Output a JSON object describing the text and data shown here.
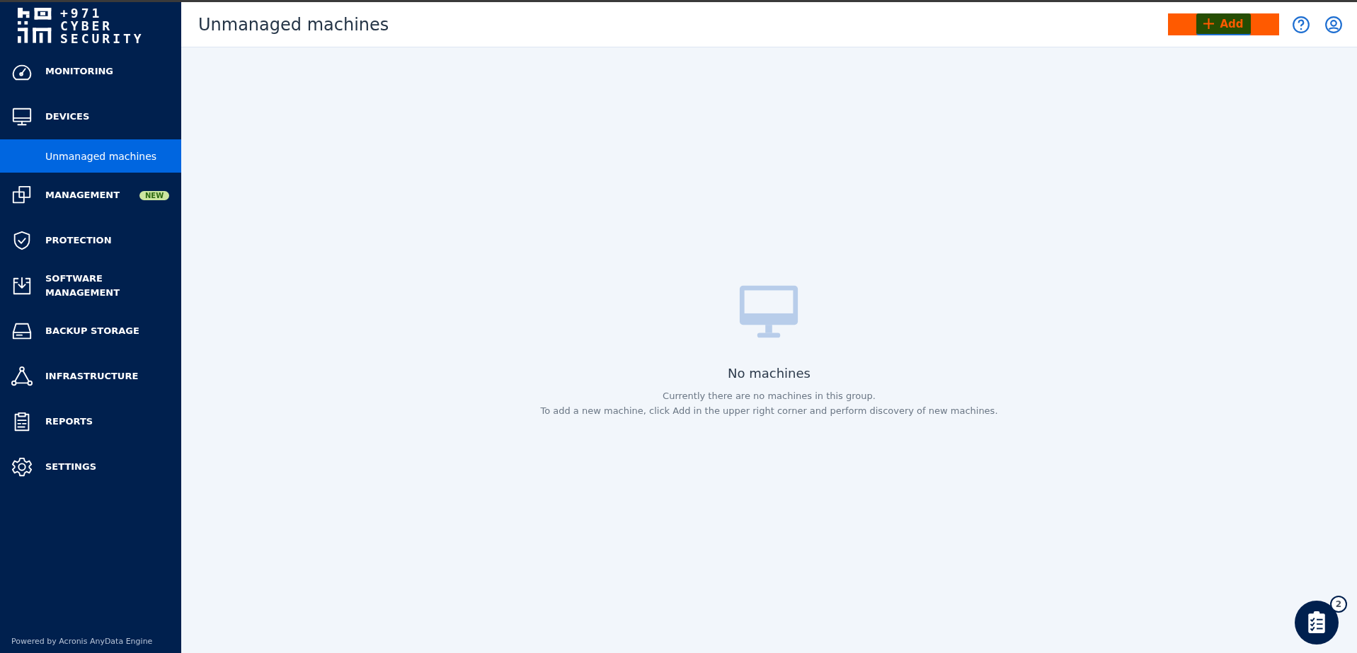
{
  "logo": {
    "lines": [
      "+971",
      "CYBER",
      "SECURITY"
    ]
  },
  "sidebar": {
    "items": [
      {
        "label": "MONITORING",
        "kind": "gauge",
        "selected": false
      },
      {
        "label": "DEVICES",
        "kind": "monitor",
        "selected": false,
        "children": [
          {
            "label": "Unmanaged machines",
            "selected": true
          }
        ]
      },
      {
        "label": "MANAGEMENT",
        "kind": "squares",
        "selected": false,
        "badge": "NEW"
      },
      {
        "label": "PROTECTION",
        "kind": "shield",
        "selected": false
      },
      {
        "label": "SOFTWARE MANAGEMENT",
        "kind": "download",
        "selected": false
      },
      {
        "label": "BACKUP STORAGE",
        "kind": "drive",
        "selected": false
      },
      {
        "label": "INFRASTRUCTURE",
        "kind": "triangle",
        "selected": false
      },
      {
        "label": "REPORTS",
        "kind": "clipboard",
        "selected": false
      },
      {
        "label": "SETTINGS",
        "kind": "gear",
        "selected": false
      }
    ],
    "footer": "Powered by Acronis AnyData Engine"
  },
  "header": {
    "title": "Unmanaged machines",
    "add_button": "Add"
  },
  "empty_state": {
    "title": "No machines",
    "lines": [
      "Currently there are no machines in this group.",
      "To add a new machine, click Add in the upper right corner and perform discovery of new machines."
    ]
  },
  "tasks_button": {
    "count": "2"
  }
}
